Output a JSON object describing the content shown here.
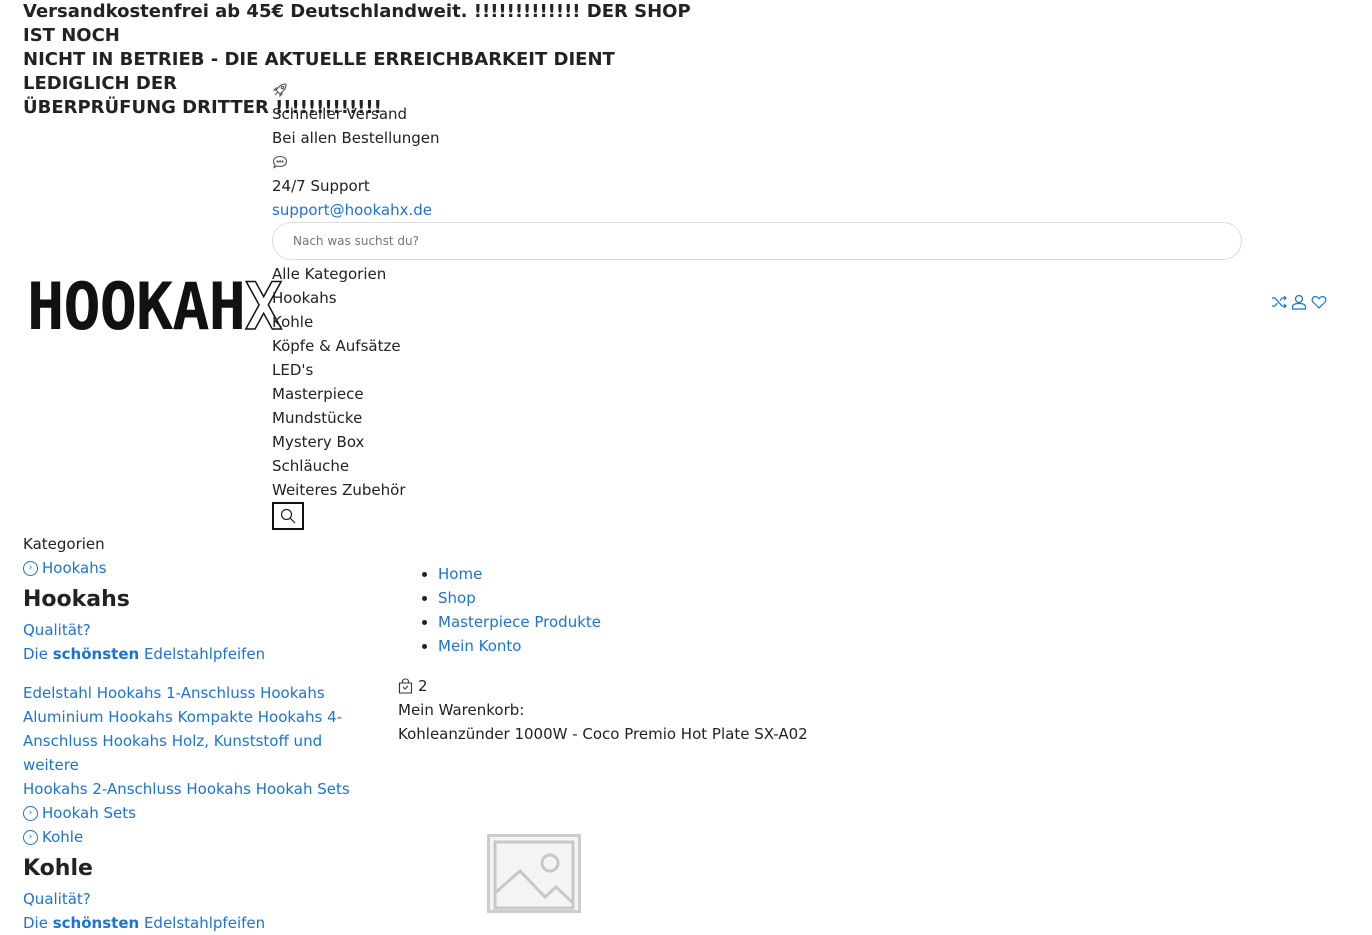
{
  "banner": {
    "line1": "Versandkostenfrei ab 45€ Deutschlandweit. !!!!!!!!!!!!! DER SHOP IST NOCH",
    "line2": "NICHT IN BETRIEB - DIE AKTUELLE ERREICHBARKEIT DIENT LEDIGLICH DER",
    "line3": "ÜBERPRÜFUNG DRITTER !!!!!!!!!!!!!"
  },
  "logo": {
    "main": "HOOKAH",
    "accent": "X"
  },
  "features": [
    {
      "icon": "rocket-icon",
      "title": "Schneller Versand",
      "subtitle": "Bei allen Bestellungen"
    },
    {
      "icon": "chat-icon",
      "title": "24/7 Support",
      "subtitle": "support@hookahx.de"
    }
  ],
  "search": {
    "placeholder": "Nach was suchst du?",
    "categories": [
      "Alle Kategorien",
      "Hookahs",
      "Kohle",
      "Köpfe & Aufsätze",
      "LED's",
      "Masterpiece",
      "Mundstücke",
      "Mystery Box",
      "Schläuche",
      "Weiteres Zubehör"
    ]
  },
  "header_icons": [
    "shuffle-icon",
    "user-icon",
    "heart-icon"
  ],
  "sidebar": {
    "heading": "Kategorien",
    "hookahs": {
      "link": "Hookahs",
      "title": "Hookahs",
      "q": "Qualität?",
      "desc_prefix": "Die",
      "desc_bold": "schönsten",
      "desc_suffix": "Edelstahlpfeifen",
      "sub1": "Edelstahl Hookahs 1-Anschluss Hookahs",
      "sub2": "Aluminium Hookahs Kompakte Hookahs 4-",
      "sub3": "Anschluss Hookahs Holz, Kunststoff und weitere",
      "sub4": "Hookahs 2-Anschluss Hookahs Hookah Sets"
    },
    "hookah_sets": "Hookah Sets",
    "kohle": {
      "link": "Kohle",
      "title": "Kohle",
      "q": "Qualität?",
      "desc_prefix": "Die",
      "desc_bold": "schönsten",
      "desc_suffix": "Edelstahlpfeifen"
    }
  },
  "nav": [
    "Home",
    "Shop",
    "Masterpiece Produkte",
    "Mein Konto"
  ],
  "cart": {
    "count": "2",
    "label": "Mein Warenkorb:",
    "product": "Kohleanzünder 1000W - Coco Premio Hot Plate SX-A02"
  }
}
